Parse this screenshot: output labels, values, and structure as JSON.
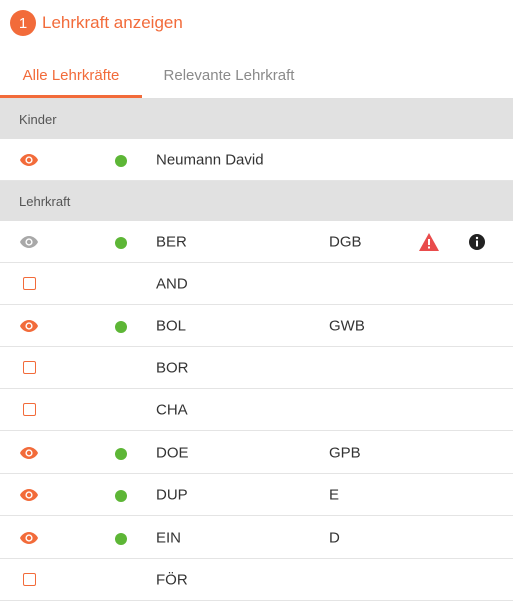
{
  "header": {
    "step_number": "1",
    "title": "Lehrkraft anzeigen"
  },
  "tabs": [
    {
      "label": "Alle Lehrkräfte",
      "active": true
    },
    {
      "label": "Relevante Lehrkraft",
      "active": false
    }
  ],
  "sections": {
    "kinder": {
      "label": "Kinder",
      "rows": [
        {
          "icon": "eye-icon",
          "status": "active",
          "name": "Neumann David"
        }
      ]
    },
    "lehrkraft": {
      "label": "Lehrkraft",
      "rows": [
        {
          "icon": "eye-icon-gray",
          "status": "active",
          "name": "BER",
          "code": "DGB",
          "warning": true,
          "info": true
        },
        {
          "icon": "checkbox",
          "name": "AND"
        },
        {
          "icon": "eye-icon",
          "status": "active",
          "name": "BOL",
          "code": "GWB"
        },
        {
          "icon": "checkbox",
          "name": "BOR"
        },
        {
          "icon": "checkbox",
          "name": "CHA"
        },
        {
          "icon": "eye-icon",
          "status": "active",
          "name": "DOE",
          "code": "GPB"
        },
        {
          "icon": "eye-icon",
          "status": "active",
          "name": "DUP",
          "code": "E"
        },
        {
          "icon": "eye-icon",
          "status": "active",
          "name": "EIN",
          "code": "D"
        },
        {
          "icon": "checkbox",
          "name": "FÖR"
        }
      ]
    }
  },
  "colors": {
    "accent": "#f26b3a",
    "status_dot": "#5db636",
    "warning": "#e94c4c",
    "section_bg": "#e1e1e1"
  }
}
